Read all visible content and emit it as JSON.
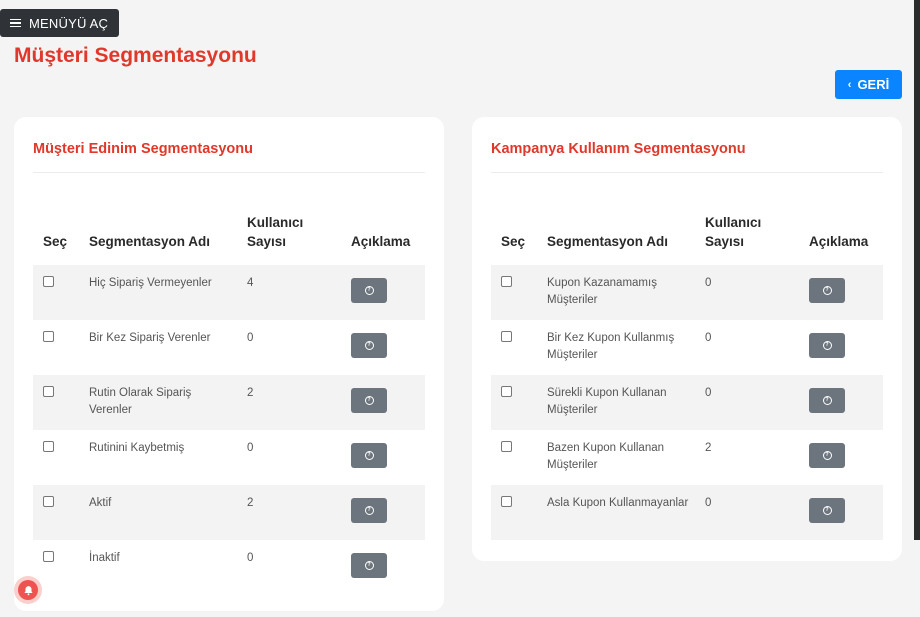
{
  "menu": {
    "label": "MENÜYÜ AÇ",
    "icon": "hamburger-icon"
  },
  "page": {
    "title": "Müşteri Segmentasyonu"
  },
  "back_button": {
    "label": "GERİ",
    "icon": "chevron-left-icon"
  },
  "colors": {
    "title_red": "#e0382a",
    "back_blue": "#0a84ff",
    "info_gray": "#6c757d",
    "menu_dark": "#2f3337"
  },
  "acquisition": {
    "title": "Müşteri Edinim Segmentasyonu",
    "headers": {
      "select": "Seç",
      "name": "Segmentasyon Adı",
      "count": "Kullanıcı Sayısı",
      "description": "Açıklama"
    },
    "rows": [
      {
        "name": "Hiç Sipariş Vermeyenler",
        "count": "4"
      },
      {
        "name": "Bir Kez Sipariş Verenler",
        "count": "0"
      },
      {
        "name": "Rutin Olarak Sipariş Verenler",
        "count": "2"
      },
      {
        "name": "Rutinini Kaybetmiş",
        "count": "0"
      },
      {
        "name": "Aktif",
        "count": "2"
      },
      {
        "name": "İnaktif",
        "count": "0"
      }
    ]
  },
  "campaign": {
    "title": "Kampanya Kullanım Segmentasyonu",
    "headers": {
      "select": "Seç",
      "name": "Segmentasyon Adı",
      "count": "Kullanıcı Sayısı",
      "description": "Açıklama"
    },
    "rows": [
      {
        "name": "Kupon Kazanamamış Müşteriler",
        "count": "0"
      },
      {
        "name": "Bir Kez Kupon Kullanmış Müşteriler",
        "count": "0"
      },
      {
        "name": "Sürekli Kupon Kullanan Müşteriler",
        "count": "0"
      },
      {
        "name": "Bazen Kupon Kullanan Müşteriler",
        "count": "2"
      },
      {
        "name": "Asla Kupon Kullanmayanlar",
        "count": "0"
      }
    ]
  },
  "info_button_icon": "info-circle-icon",
  "notification_icon": "notification-bell-icon"
}
